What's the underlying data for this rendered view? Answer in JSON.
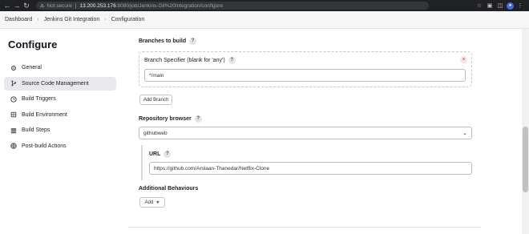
{
  "browser": {
    "security_label": "Not secure",
    "host": "13.200.253.176",
    "path": ":8080/job/Jenkins-Git%20Integration/configure"
  },
  "breadcrumb": [
    "Dashboard",
    "Jenkins Git Integration",
    "Configuration"
  ],
  "page_title": "Configure",
  "sidebar": {
    "items": [
      {
        "label": "General",
        "icon": "gear-icon"
      },
      {
        "label": "Source Code Management",
        "icon": "branch-icon",
        "active": true
      },
      {
        "label": "Build Triggers",
        "icon": "clock-icon"
      },
      {
        "label": "Build Environment",
        "icon": "cube-icon"
      },
      {
        "label": "Build Steps",
        "icon": "list-icon"
      },
      {
        "label": "Post-build Actions",
        "icon": "globe-icon"
      }
    ]
  },
  "form": {
    "branches_label": "Branches to build",
    "branch_specifier_label": "Branch Specifier (blank for 'any')",
    "branch_specifier_value": "*/main",
    "add_branch_label": "Add Branch",
    "repo_browser_label": "Repository browser",
    "repo_browser_value": "githubweb",
    "url_label": "URL",
    "url_value": "https://github.com/Arslaan-Thanedar/Netflix-Clone",
    "additional_behaviours_label": "Additional Behaviours",
    "add_label": "Add",
    "help_glyph": "?",
    "close_glyph": "×"
  },
  "colors": {
    "active_sidebar": "#e9e9ed",
    "chrome_bg": "#202124"
  }
}
